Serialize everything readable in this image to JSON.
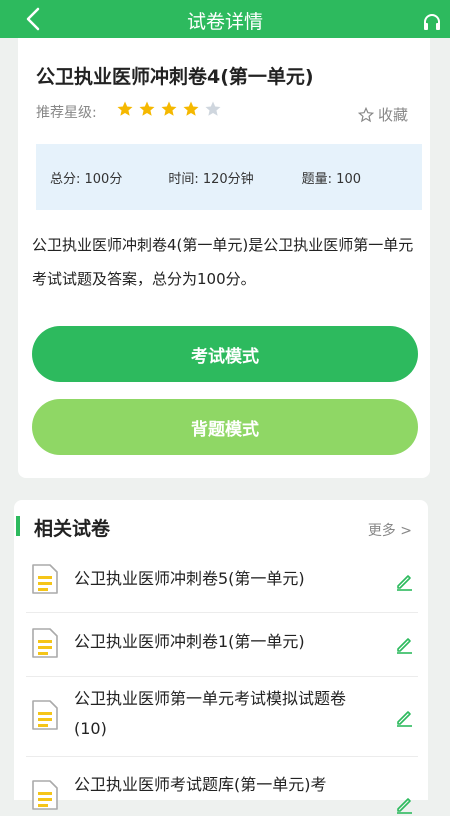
{
  "header": {
    "title": "试卷详情"
  },
  "exam": {
    "title": "公卫执业医师冲刺卷4(第一单元)",
    "rating_label": "推荐星级:",
    "rating": 4,
    "rating_max": 5,
    "favorite_label": "收藏",
    "stats": {
      "total_score": "总分: 100分",
      "time": "时间: 120分钟",
      "question_count": "题量: 100"
    },
    "description": "公卫执业医师冲刺卷4(第一单元)是公卫执业医师第一单元考试试题及答案，总分为100分。",
    "exam_mode_label": "考试模式",
    "recite_mode_label": "背题模式"
  },
  "related": {
    "title": "相关试卷",
    "more_label": "更多 >",
    "items": [
      {
        "name": "公卫执业医师冲刺卷5(第一单元)"
      },
      {
        "name": "公卫执业医师冲刺卷1(第一单元)"
      },
      {
        "name": "公卫执业医师第一单元考试模拟试题卷(10)"
      },
      {
        "name": "公卫执业医师考试题库(第一单元)考"
      }
    ]
  },
  "colors": {
    "primary": "#2dba5e",
    "secondary": "#8fd765",
    "star": "#f5b800",
    "star_empty": "#cfd6de"
  }
}
